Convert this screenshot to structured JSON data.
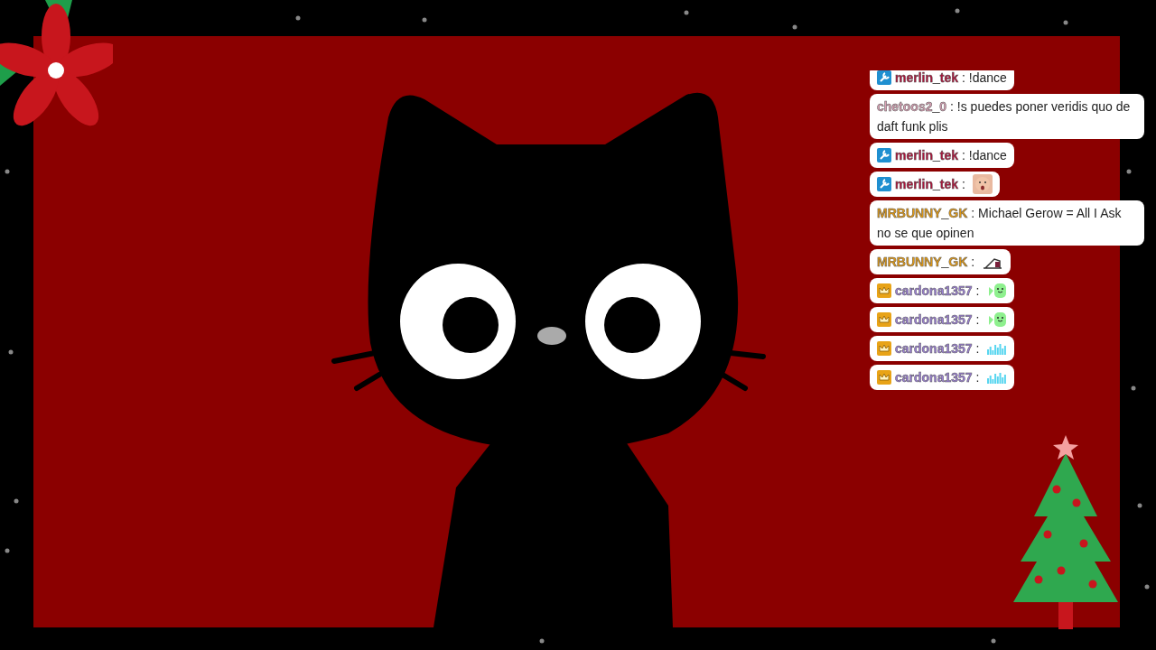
{
  "chat": [
    {
      "badge": {
        "kind": "wrench"
      },
      "user": "merlin_tek",
      "color": "#b0123a",
      "text": ": !dance"
    },
    {
      "user": "chetoos2_0",
      "color": "#d9a0b4",
      "text": ": !s puedes poner veridis quo de daft funk plis"
    },
    {
      "badge": {
        "kind": "wrench"
      },
      "user": "merlin_tek",
      "color": "#b0123a",
      "text": ": !dance"
    },
    {
      "badge": {
        "kind": "wrench"
      },
      "user": "merlin_tek",
      "color": "#b0123a",
      "text": ":",
      "emote": {
        "kind": "face"
      }
    },
    {
      "user": "MRBUNNY_GK",
      "color": "#e39a12",
      "text": ": Michael Gerow = All I Ask no se que opinen"
    },
    {
      "user": "MRBUNNY_GK",
      "color": "#e39a12",
      "text": ":",
      "emote": {
        "kind": "sled"
      }
    },
    {
      "badge": {
        "kind": "crown"
      },
      "user": "cardona1357",
      "color": "#9b7fd6",
      "text": ":",
      "emote": {
        "kind": "ghost"
      }
    },
    {
      "badge": {
        "kind": "crown"
      },
      "user": "cardona1357",
      "color": "#9b7fd6",
      "text": ":",
      "emote": {
        "kind": "ghost"
      }
    },
    {
      "badge": {
        "kind": "crown"
      },
      "user": "cardona1357",
      "color": "#9b7fd6",
      "text": ":",
      "emote": {
        "kind": "bars"
      }
    },
    {
      "badge": {
        "kind": "crown"
      },
      "user": "cardona1357",
      "color": "#9b7fd6",
      "text": ":",
      "emote": {
        "kind": "bars"
      }
    }
  ]
}
